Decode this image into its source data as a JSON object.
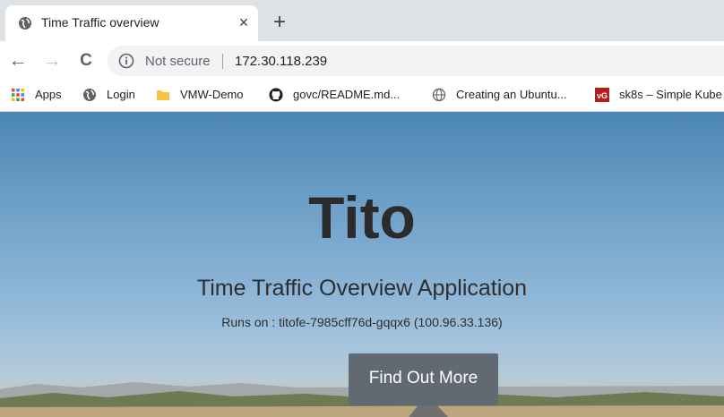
{
  "browser": {
    "tab": {
      "title": "Time Traffic overview",
      "close_glyph": "×",
      "favicon": "globe-icon"
    },
    "new_tab_glyph": "+",
    "toolbar": {
      "back_glyph": "←",
      "forward_glyph": "→",
      "reload_glyph": "C"
    },
    "omnibox": {
      "security_label": "Not secure",
      "url": "172.30.118.239",
      "icon": "info-icon"
    },
    "bookmarks": [
      {
        "label": "Apps",
        "icon": "apps-grid-icon"
      },
      {
        "label": "Login",
        "icon": "globe-icon"
      },
      {
        "label": "VMW-Demo",
        "icon": "folder-icon"
      },
      {
        "label": "govc/README.md...",
        "icon": "github-icon"
      },
      {
        "label": "Creating an Ubuntu...",
        "icon": "web-icon"
      },
      {
        "label": "sk8s – Simple Kube",
        "icon": "vg-logo-icon"
      }
    ]
  },
  "page": {
    "title": "Tito",
    "subtitle": "Time Traffic Overview Application",
    "runs_on": "Runs on : titofe-7985cff76d-gqqx6 (100.96.33.136)",
    "cta_label": "Find Out More"
  },
  "colors": {
    "tab_strip": "#dee1e6",
    "omnibox_bg": "#f1f3f4",
    "cta_bg": "#616a72",
    "sky_top": "#4b86b4"
  }
}
